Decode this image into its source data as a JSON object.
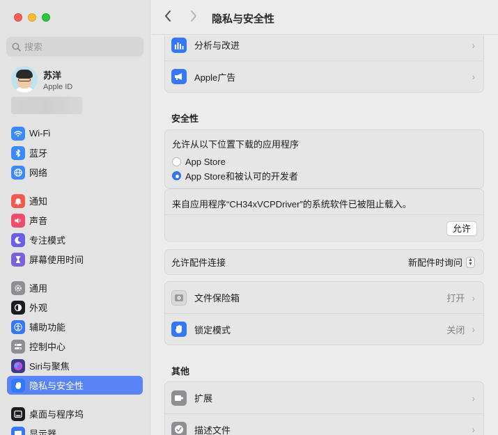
{
  "window": {
    "title": "隐私与安全性"
  },
  "sidebar": {
    "search_placeholder": "搜索",
    "account": {
      "name": "苏洋",
      "subtitle": "Apple ID"
    },
    "items": [
      {
        "label": "Wi-Fi",
        "icon": "wifi-icon",
        "color": "#3c8af7"
      },
      {
        "label": "蓝牙",
        "icon": "bluetooth-icon",
        "color": "#3c8af7"
      },
      {
        "label": "网络",
        "icon": "globe-icon",
        "color": "#3c8af7"
      },
      {
        "label": "通知",
        "icon": "bell-icon",
        "color": "#f25a4e"
      },
      {
        "label": "声音",
        "icon": "speaker-icon",
        "color": "#f04b6a"
      },
      {
        "label": "专注模式",
        "icon": "moon-icon",
        "color": "#6c5ce7"
      },
      {
        "label": "屏幕使用时间",
        "icon": "hourglass-icon",
        "color": "#7b61d9"
      },
      {
        "label": "通用",
        "icon": "gear-icon",
        "color": "#8e8e93"
      },
      {
        "label": "外观",
        "icon": "appearance-icon",
        "color": "#1c1c1e"
      },
      {
        "label": "辅助功能",
        "icon": "accessibility-icon",
        "color": "#3478f6"
      },
      {
        "label": "控制中心",
        "icon": "control-center-icon",
        "color": "#8e8e93"
      },
      {
        "label": "Siri与聚焦",
        "icon": "siri-icon",
        "color": "#3a3a8c"
      },
      {
        "label": "隐私与安全性",
        "icon": "hand-icon",
        "color": "#3478f6"
      },
      {
        "label": "桌面与程序坞",
        "icon": "dock-icon",
        "color": "#1c1c1e"
      },
      {
        "label": "显示器",
        "icon": "display-icon",
        "color": "#3478f6"
      }
    ],
    "selected_index": 12
  },
  "toolbar": {
    "back": "‹",
    "forward": "›",
    "title": "隐私与安全性"
  },
  "top_group": [
    {
      "label": "分析与改进",
      "icon": "analytics-icon",
      "color": "#3478f6"
    },
    {
      "label": "Apple广告",
      "icon": "megaphone-icon",
      "color": "#3478f6"
    }
  ],
  "security": {
    "title": "安全性",
    "allow_title": "允许从以下位置下载的应用程序",
    "options": [
      {
        "label": "App Store",
        "selected": false
      },
      {
        "label": "App Store和被认可的开发者",
        "selected": true
      }
    ],
    "blocked_message": "来自应用程序“CH34xVCPDriver”的系统软件已被阻止载入。",
    "allow_button": "允许",
    "accessory_label": "允许配件连接",
    "accessory_value": "新配件时询问",
    "filevault": {
      "label": "文件保险箱",
      "value": "打开"
    },
    "lockdown": {
      "label": "锁定模式",
      "value": "关闭"
    }
  },
  "other": {
    "title": "其他",
    "items": [
      {
        "label": "扩展",
        "icon": "extension-icon"
      },
      {
        "label": "描述文件",
        "icon": "profile-icon"
      }
    ]
  }
}
